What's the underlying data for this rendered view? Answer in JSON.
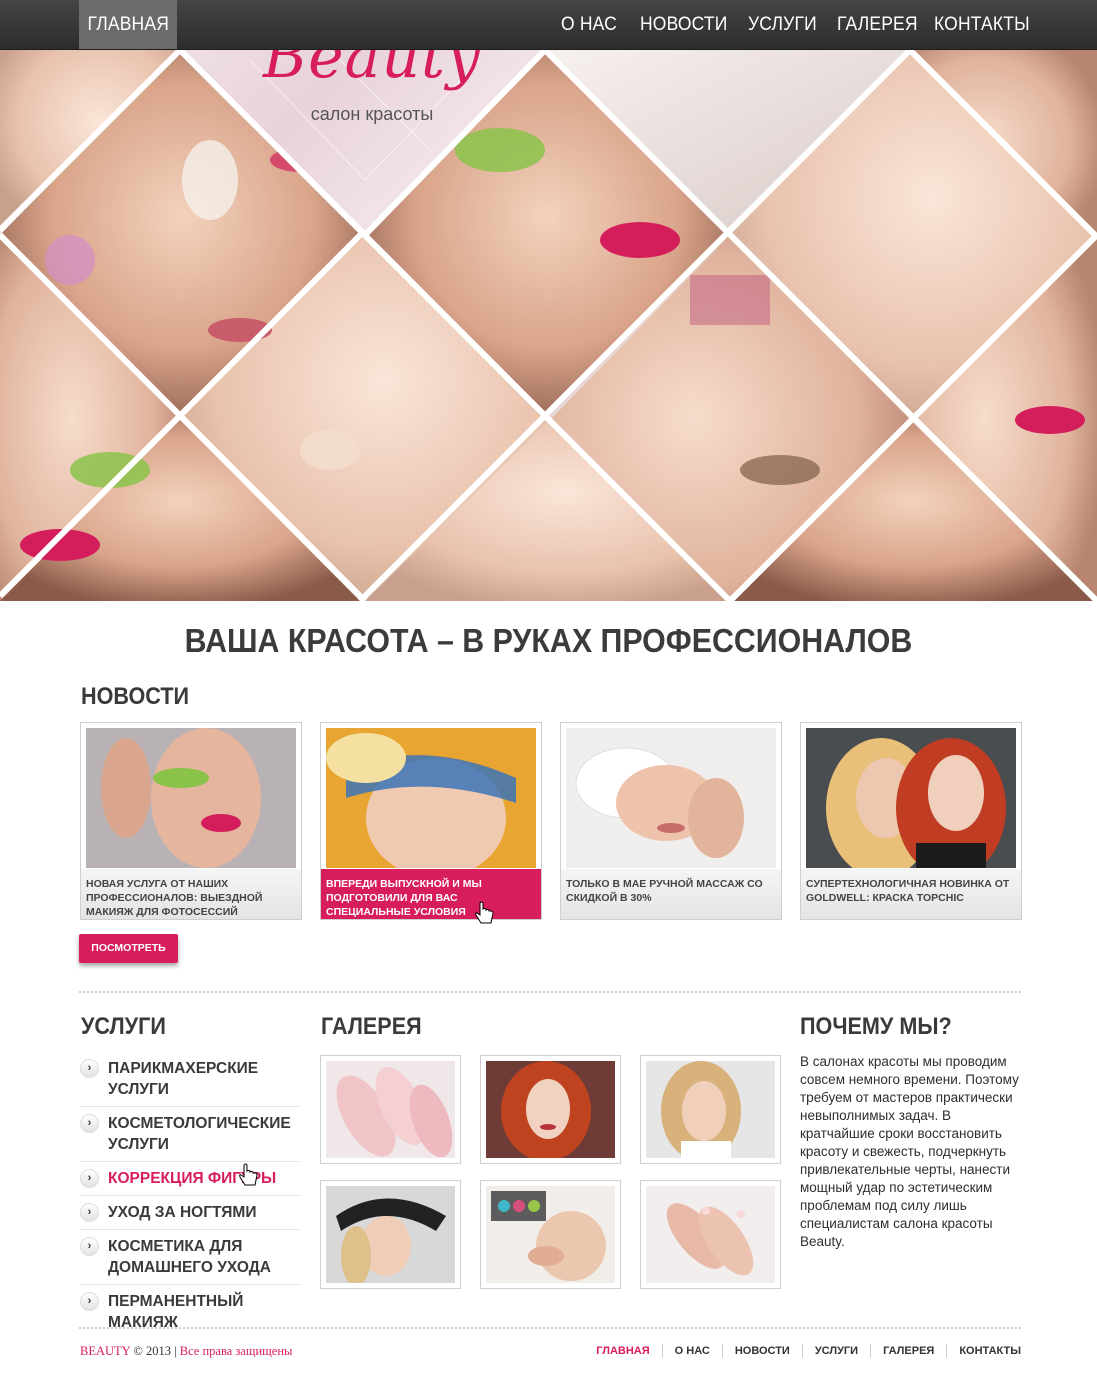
{
  "nav": {
    "home": "ГЛАВНАЯ",
    "items": [
      "О НАС",
      "НОВОСТИ",
      "УСЛУГИ",
      "ГАЛЕРЕЯ",
      "КОНТАКТЫ"
    ]
  },
  "logo": {
    "title": "Beauty",
    "subtitle": "салон красоты"
  },
  "tagline": "ВАША КРАСОТА – В РУКАХ ПРОФЕССИОНАЛОВ",
  "news": {
    "title": "НОВОСТИ",
    "items": [
      {
        "caption": "НОВАЯ УСЛУГА ОТ НАШИХ ПРОФЕССИОНАЛОВ: ВЫЕЗДНОЙ МАКИЯЖ ДЛЯ ФОТОСЕССИЙ"
      },
      {
        "caption": "ВПЕРЕДИ ВЫПУСКНОЙ И МЫ ПОДГОТОВИЛИ ДЛЯ ВАС СПЕЦИАЛЬНЫЕ УСЛОВИЯ"
      },
      {
        "caption": "ТОЛЬКО В МАЕ РУЧНОЙ МАССАЖ СО СКИДКОЙ В 30%"
      },
      {
        "caption": "СУПЕРТЕХНОЛОГИЧНАЯ НОВИНКА ОТ GOLDWELL: КРАСКА TOPCHIC"
      }
    ],
    "view_all": "ПОСМОТРЕТЬ ВСЕ"
  },
  "services": {
    "title": "УСЛУГИ",
    "items": [
      "ПАРИКМАХЕРСКИЕ УСЛУГИ",
      "КОСМЕТОЛОГИЧЕСКИЕ УСЛУГИ",
      "КОРРЕКЦИЯ ФИГУРЫ",
      "УХОД ЗА НОГТЯМИ",
      "КОСМЕТИКА ДЛЯ ДОМАШНЕГО УХОДА",
      "ПЕРМАНЕНТНЫЙ МАКИЯЖ"
    ]
  },
  "gallery": {
    "title": "ГАЛЕРЕЯ"
  },
  "why": {
    "title": "ПОЧЕМУ МЫ?",
    "text": "В салонах красоты мы проводим совсем немного времени. Поэтому требуем от мастеров практически невыполнимых задач. В кратчайшие сроки восстановить красоту и свежесть, подчеркнуть привлекательные черты, нанести мощный удар по эстетическим проблемам под силу лишь специалистам салона красоты Beauty."
  },
  "footer": {
    "brand": "BEAUTY",
    "year": "© 2013",
    "rights": "Все права защищены",
    "nav": [
      "ГЛАВНАЯ",
      "О НАС",
      "НОВОСТИ",
      "УСЛУГИ",
      "ГАЛЕРЕЯ",
      "КОНТАКТЫ"
    ]
  },
  "colors": {
    "accent": "#d81d5c",
    "topbar": "#353535",
    "text": "#3a3a3a"
  }
}
